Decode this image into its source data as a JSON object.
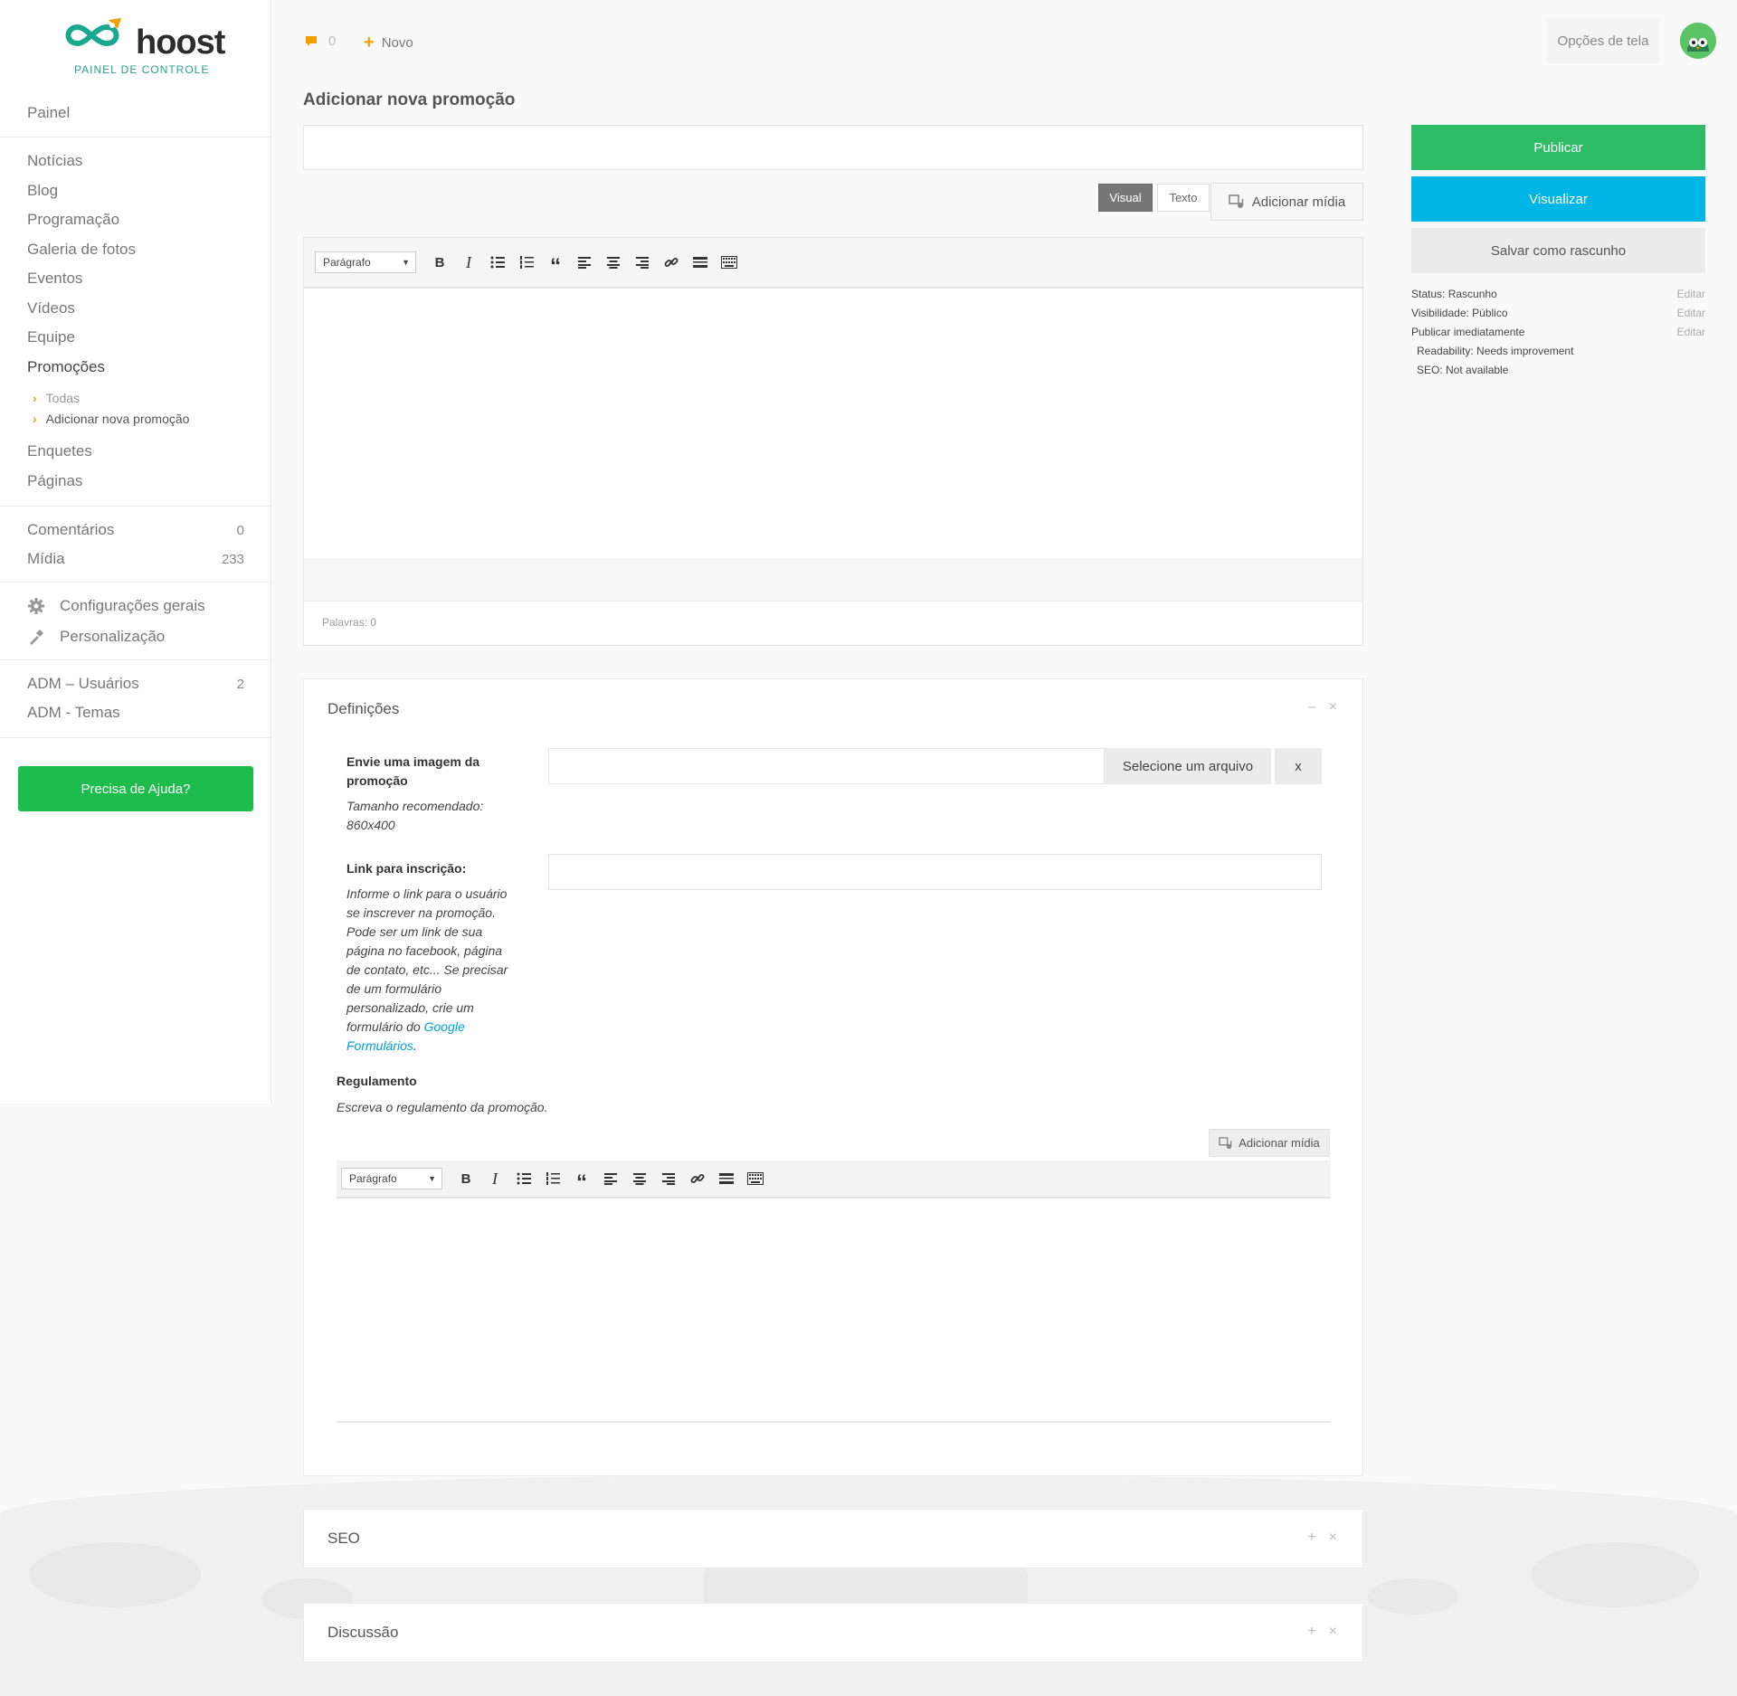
{
  "brand": {
    "name": "hoost",
    "subtitle": "PAINEL DE CONTROLE"
  },
  "sidebar": {
    "items": [
      {
        "label": "Painel"
      },
      {
        "label": "Notícias"
      },
      {
        "label": "Blog"
      },
      {
        "label": "Programação"
      },
      {
        "label": "Galeria de fotos"
      },
      {
        "label": "Eventos"
      },
      {
        "label": "Vídeos"
      },
      {
        "label": "Equipe"
      },
      {
        "label": "Promoções"
      },
      {
        "label": "Enquetes"
      },
      {
        "label": "Páginas"
      },
      {
        "label": "Comentários",
        "count": "0"
      },
      {
        "label": "Mídia",
        "count": "233"
      },
      {
        "label": "Configurações gerais",
        "icon": "gear-icon"
      },
      {
        "label": "Personalização",
        "icon": "brush-icon"
      },
      {
        "label": "ADM – Usuários",
        "count": "2"
      },
      {
        "label": "ADM - Temas"
      }
    ],
    "subitems": [
      {
        "label": "Todas"
      },
      {
        "label": "Adicionar nova promoção"
      }
    ],
    "help_button": "Precisa de Ajuda?"
  },
  "topbar": {
    "comment_count": "0",
    "new_label": "Novo",
    "screen_options": "Opções de tela"
  },
  "main": {
    "page_title": "Adicionar nova promoção",
    "title_placeholder": "",
    "tabs": {
      "visual": "Visual",
      "text": "Texto"
    },
    "add_media": "Adicionar mídia",
    "format_select": "Parágrafo",
    "word_count": "Palavras: 0"
  },
  "publish": {
    "publish": "Publicar",
    "preview": "Visualizar",
    "save_draft": "Salvar como rascunho",
    "status": "Status: Rascunho",
    "visibility": "Visibilidade: Público",
    "schedule": "Publicar imediatamente",
    "readability": "Readability: Needs improvement",
    "seo": "SEO: Not available",
    "edit": "Editar"
  },
  "definitions": {
    "title": "Definições",
    "image_label": "Envie uma imagem da promoção",
    "image_hint": "Tamanho recomendado: 860x400",
    "select_file": "Selecione um arquivo",
    "clear": "x",
    "link_label": "Link para inscrição:",
    "link_hint": "Informe o link para o usuário se inscrever na promoção. Pode ser um link de sua página no facebook, página de contato, etc... Se precisar de um formulário personalizado, crie um formulário do ",
    "link_hint_link": "Google Formulários",
    "link_hint_end": ".",
    "rules_label": "Regulamento",
    "rules_hint": "Escreva o regulamento da promoção.",
    "add_media": "Adicionar mídia",
    "format_select": "Parágrafo"
  },
  "panels": {
    "seo": "SEO",
    "discussion": "Discussão"
  },
  "colors": {
    "primary_green": "#2ebc67",
    "cyan": "#00b6e6",
    "accent_orange": "#f0a000",
    "help_green": "#1ebc4c"
  }
}
